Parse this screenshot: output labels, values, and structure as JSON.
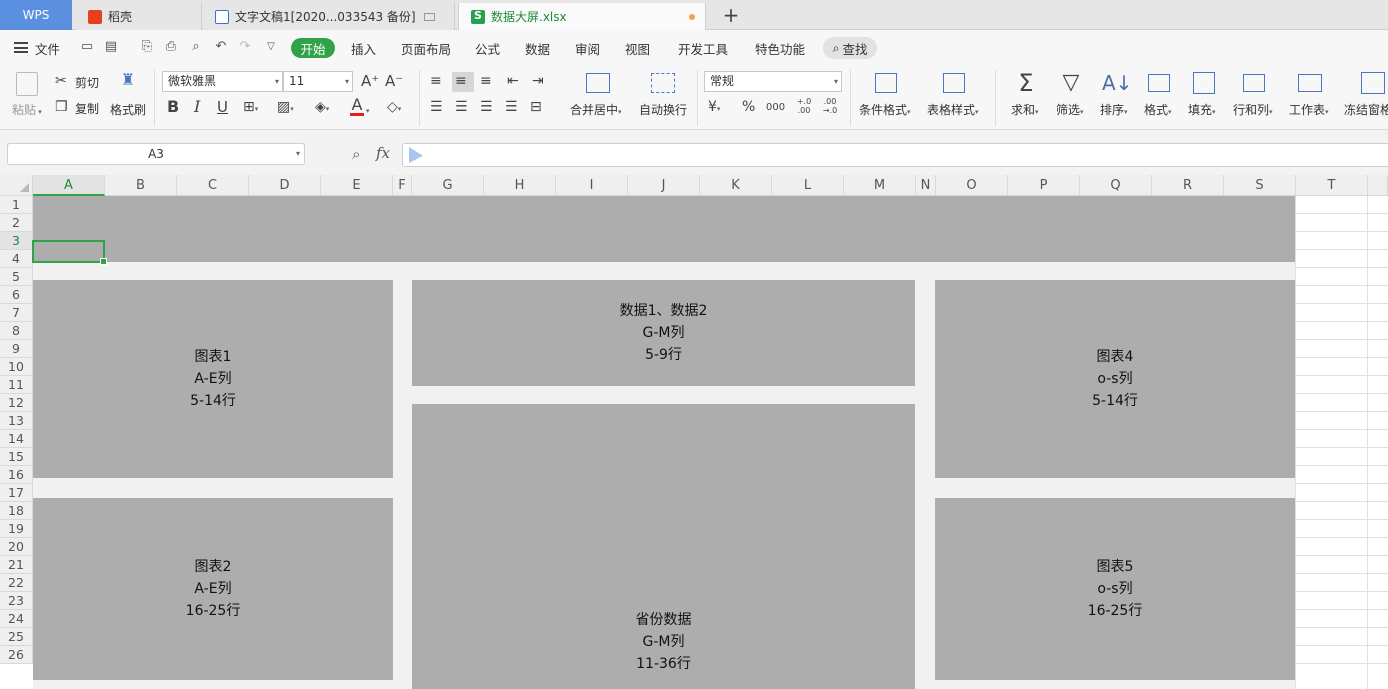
{
  "tabs": {
    "wps": "WPS",
    "items": [
      {
        "label": "稻壳",
        "icon": "docer-fire-icon"
      },
      {
        "label": "文字文稿1[2020...033543 备份]",
        "icon": "word-doc-icon"
      },
      {
        "label": "数据大屏.xlsx",
        "icon": "sheet-doc-icon"
      }
    ],
    "new_tab": "+"
  },
  "menu": {
    "file": "文件",
    "start": "开始",
    "items": [
      "插入",
      "页面布局",
      "公式",
      "数据",
      "审阅",
      "视图",
      "开发工具",
      "特色功能"
    ],
    "search": "查找"
  },
  "ribbon": {
    "paste": "粘贴",
    "cut": "剪切",
    "copy": "复制",
    "format_painter": "格式刷",
    "font_name": "微软雅黑",
    "font_size": "11",
    "bold": "B",
    "italic": "I",
    "underline": "U",
    "font_color_letter": "A",
    "merge_center": "合并居中",
    "wrap_text": "自动换行",
    "number_format": "常规",
    "currency": "¥",
    "percent": "%",
    "thousands": "000",
    "inc_decimal": "+.0 .00",
    "dec_decimal": ".00 →.0",
    "conditional_format": "条件格式",
    "table_style": "表格样式",
    "sum": "求和",
    "filter": "筛选",
    "sort": "排序",
    "format": "格式",
    "fill": "填充",
    "rows_cols": "行和列",
    "worksheet": "工作表",
    "freeze": "冻结窗格"
  },
  "formula_bar": {
    "name_box": "A3",
    "fx": "fx",
    "value": ""
  },
  "grid": {
    "selected_cell": "A3",
    "columns": [
      "A",
      "B",
      "C",
      "D",
      "E",
      "F",
      "G",
      "H",
      "I",
      "J",
      "K",
      "L",
      "M",
      "N",
      "O",
      "P",
      "Q",
      "R",
      "S",
      "T"
    ],
    "rows": [
      "1",
      "2",
      "3",
      "4",
      "5",
      "6",
      "7",
      "8",
      "9",
      "10",
      "11",
      "12",
      "13",
      "14",
      "15",
      "16",
      "17",
      "18",
      "19",
      "20",
      "21",
      "22",
      "23",
      "24",
      "25",
      "26"
    ],
    "blocks": {
      "chart1": {
        "title": "图表1",
        "cols": "A-E列",
        "rows": "5-14行"
      },
      "data12": {
        "title": "数据1、数据2",
        "cols": "G-M列",
        "rows": "5-9行"
      },
      "chart4": {
        "title": "图表4",
        "cols": "o-s列",
        "rows": "5-14行"
      },
      "chart2": {
        "title": "图表2",
        "cols": "A-E列",
        "rows": "16-25行"
      },
      "province": {
        "title": "省份数据",
        "cols": "G-M列",
        "rows": "11-36行"
      },
      "chart5": {
        "title": "图表5",
        "cols": "o-s列",
        "rows": "16-25行"
      }
    },
    "block_color": "#adadad"
  }
}
